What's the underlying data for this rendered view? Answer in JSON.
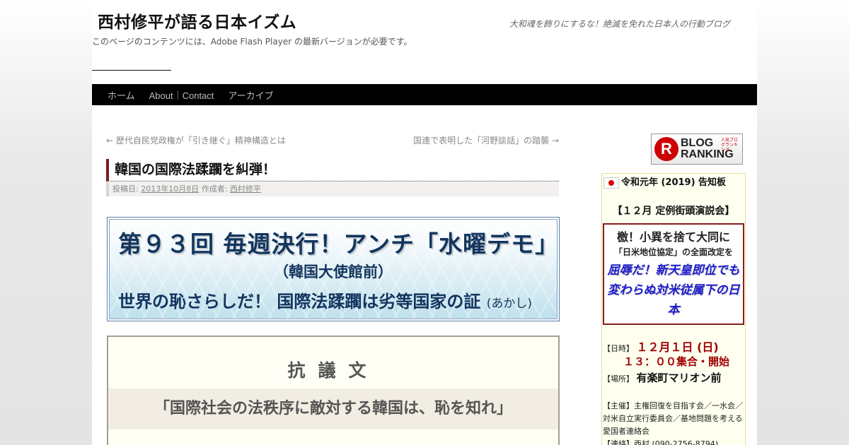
{
  "site": {
    "title": "西村修平が語る日本イズム",
    "description": "大和魂を飾りにするな！絶滅を免れた日本人の行動ブログ",
    "flash_note": "このページのコンテンツには、Adobe Flash Player の最新バージョンが必要です。"
  },
  "nav": {
    "items": [
      "ホーム",
      "About｜Contact",
      "アーカイブ"
    ]
  },
  "post_nav": {
    "prev": "← 歴代自民党政権が「引き継ぐ」精神構造とは",
    "next": "国連で表明した「河野談話」の踏襲 →"
  },
  "entry": {
    "title": "韓国の国際法蹂躙を糾弾！",
    "meta_prefix": "投稿日:",
    "date": "2013年10月8日",
    "author_prefix": "作成者:",
    "author": "西村修平"
  },
  "banner": {
    "line1": "第９３回 毎週決行！アンチ「水曜デモ」",
    "line2": "（韓国大使館前）",
    "line3": "世界の恥さらしだ！ 国際法蹂躙は劣等国家の証",
    "line3_small": "(あかし)"
  },
  "protest": {
    "heading": "抗議文",
    "subheading": "「国際社会の法秩序に敵対する韓国は、恥を知れ」"
  },
  "sidebar": {
    "badge": {
      "letter": "R",
      "line1": "BLOG",
      "line2": "RANKING",
      "tiny": "人気ブログランキング"
    },
    "notice_title": "令和元年 (2019) 告知板",
    "event_title": "【１２月 定例街頭演説会】",
    "redbox": {
      "line1": "檄！小異を捨て大同に",
      "line2": "「日米地位協定」の全面改定を",
      "line3": "屈辱だ！新天皇即位でも変わらぬ対米従属下の日本"
    },
    "date_label": "【日時】",
    "date_value": "１２月１日 (日)",
    "time_value": "１３：００集合・開始",
    "place_label": "【場所】",
    "place_value": "有楽町マリオン前",
    "organizer_label": "【主催】",
    "organizer_value": "主権回復を目指す会／一水会／対米自立実行委員会／基地問題を考える愛国者連絡会",
    "contact_label": "【連絡】",
    "contact_value": "西村 (090-2756-8794)"
  }
}
